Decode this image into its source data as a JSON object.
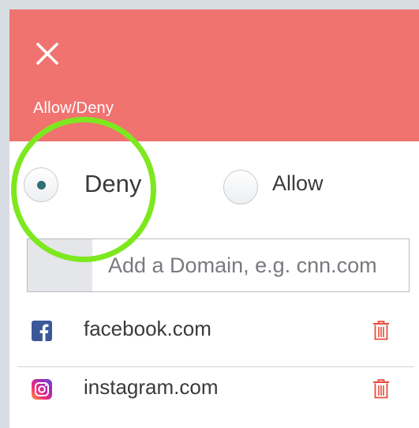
{
  "header": {
    "title": "Allow/Deny",
    "close_icon": "close-icon",
    "background_color": "#f07370"
  },
  "mode": {
    "options": [
      {
        "label": "Deny",
        "selected": true
      },
      {
        "label": "Allow",
        "selected": false
      }
    ]
  },
  "domain_input": {
    "placeholder": "Add a Domain, e.g. cnn.com",
    "value": ""
  },
  "domains": [
    {
      "name": "facebook.com",
      "icon": "facebook-icon"
    },
    {
      "name": "instagram.com",
      "icon": "instagram-icon"
    }
  ],
  "colors": {
    "accent": "#f07370",
    "highlight": "#7ee81f",
    "delete": "#e74c3c"
  }
}
